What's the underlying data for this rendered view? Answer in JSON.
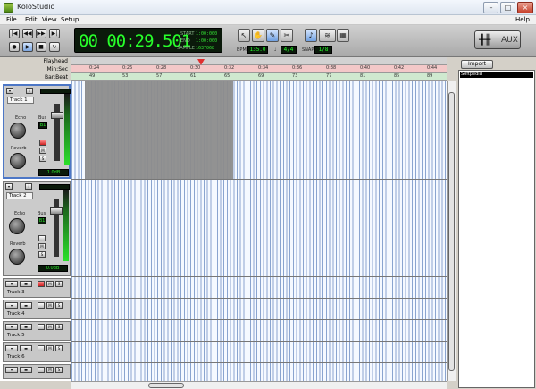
{
  "window": {
    "title": "KoloStudio",
    "help": "Help"
  },
  "menu": [
    "File",
    "Edit",
    "View",
    "Setup"
  ],
  "transport": {
    "icons": [
      "rewind-start-icon",
      "rewind-icon",
      "fast-forward-icon",
      "go-end-icon",
      "record-icon",
      "play-icon",
      "stop-icon",
      "loop-icon"
    ]
  },
  "counter": {
    "time": "00 00:29.501",
    "start_label": "START",
    "start_value": "1:00:000",
    "end_label": "END",
    "end_value": "1:00:000",
    "sample_label": "SAMPLE",
    "sample_value": "1637068"
  },
  "bpm": {
    "label": "BPM",
    "value": "135.0"
  },
  "meter": {
    "value": "4/4"
  },
  "snap": {
    "label": "SNAP",
    "value": "1/8"
  },
  "aux": {
    "label": "AUX"
  },
  "ruler": {
    "labels": [
      "Playhead",
      "Min:Sec",
      "Bar:Beat"
    ],
    "minsec": [
      "0:24",
      "0:26",
      "0:28",
      "0:30",
      "0:32",
      "0:34",
      "0:36",
      "0:38",
      "0:40",
      "0:42",
      "0:44"
    ],
    "barbeat": [
      "49",
      "53",
      "57",
      "61",
      "65",
      "69",
      "73",
      "77",
      "81",
      "85",
      "89"
    ]
  },
  "tracks": [
    {
      "name": "Track 1",
      "bus": "B1",
      "bus_label": "Bus",
      "echo_label": "Echo",
      "reverb_label": "Reverb",
      "level": "1.0dB"
    },
    {
      "name": "Track 2",
      "bus": "B1",
      "bus_label": "Bus",
      "echo_label": "Echo",
      "reverb_label": "Reverb",
      "level": "0.0dB"
    },
    {
      "name": "Track 3"
    },
    {
      "name": "Track 4"
    },
    {
      "name": "Track 5"
    },
    {
      "name": "Track 6"
    }
  ],
  "browser": {
    "import_label": "Import",
    "files": [
      "Softpedia"
    ]
  }
}
